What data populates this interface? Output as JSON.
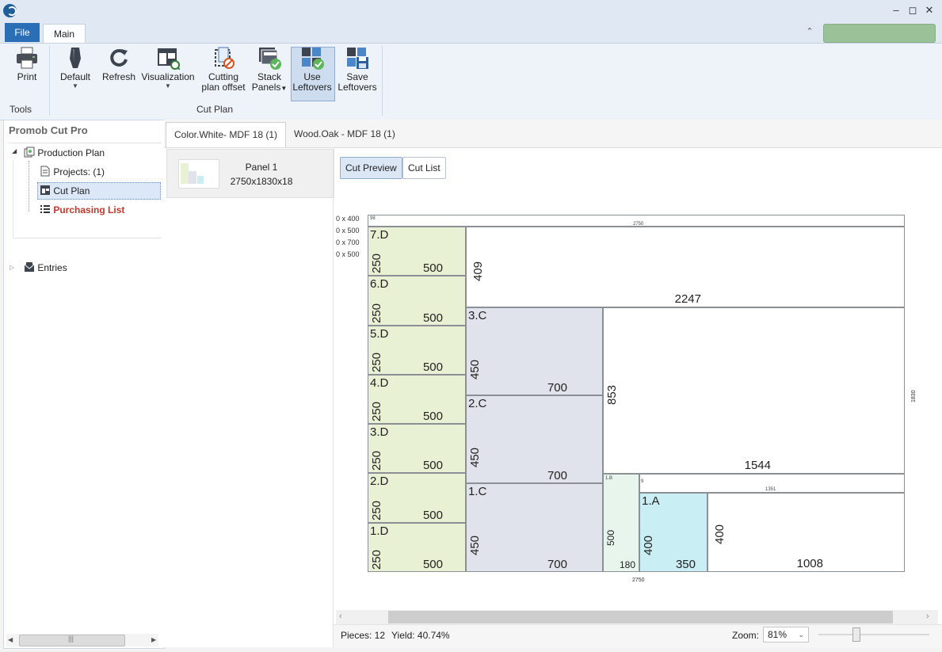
{
  "ribbon": {
    "file_tab": "File",
    "main_tab": "Main",
    "tools_group": "Tools",
    "cutplan_group": "Cut Plan",
    "print": "Print",
    "default": "Default",
    "refresh": "Refresh",
    "visualization": "Visualization",
    "cutting_offset_1": "Cutting",
    "cutting_offset_2": "plan offset",
    "stack_panels_1": "Stack",
    "stack_panels_2": "Panels",
    "use_leftovers_1": "Use",
    "use_leftovers_2": "Leftovers",
    "save_leftovers_1": "Save",
    "save_leftovers_2": "Leftovers"
  },
  "sidebar": {
    "title": "Promob Cut Pro",
    "production_plan": "Production Plan",
    "projects": "Projects: (1)",
    "cut_plan": "Cut Plan",
    "purchasing_list": "Purchasing List",
    "entries": "Entries"
  },
  "tabs": [
    "Color.White- MDF 18 (1)",
    "Wood.Oak - MDF 18 (1)"
  ],
  "panel_card": {
    "name": "Panel 1",
    "size": "2750x1830x18"
  },
  "view_buttons": {
    "cut_preview": "Cut Preview",
    "cut_list": "Cut List"
  },
  "leftovers": [
    "0 x 400",
    "0 x 500",
    "0 x 700",
    "0 x 500"
  ],
  "drawing": {
    "panel_width": "2750",
    "panel_height": "1830",
    "top_strip_label": "98",
    "top_strip_width": "2750",
    "pieces": [
      {
        "label": "7.D",
        "w": "500",
        "h": "250"
      },
      {
        "label": "6.D",
        "w": "500",
        "h": "250"
      },
      {
        "label": "5.D",
        "w": "500",
        "h": "250"
      },
      {
        "label": "4.D",
        "w": "500",
        "h": "250"
      },
      {
        "label": "3.D",
        "w": "500",
        "h": "250"
      },
      {
        "label": "2.D",
        "w": "500",
        "h": "250"
      },
      {
        "label": "1.D",
        "w": "500",
        "h": "250"
      },
      {
        "label": "3.C",
        "w": "700",
        "h": "450"
      },
      {
        "label": "2.C",
        "w": "700",
        "h": "450"
      },
      {
        "label": "1.C",
        "w": "700",
        "h": "450"
      },
      {
        "label": "1.B",
        "w": "180",
        "h": "500"
      },
      {
        "label": "1.A",
        "w": "350",
        "h": "400"
      }
    ],
    "waste": [
      {
        "w": "2247",
        "h": "409"
      },
      {
        "w": "1544",
        "h": "853"
      },
      {
        "w": "1008",
        "h": "400"
      },
      {
        "w": "1351",
        "h": "9"
      }
    ]
  },
  "status": {
    "pieces": "Pieces: 12",
    "yield": "Yield: 40.74%",
    "zoom_label": "Zoom:",
    "zoom_value": "81%"
  }
}
